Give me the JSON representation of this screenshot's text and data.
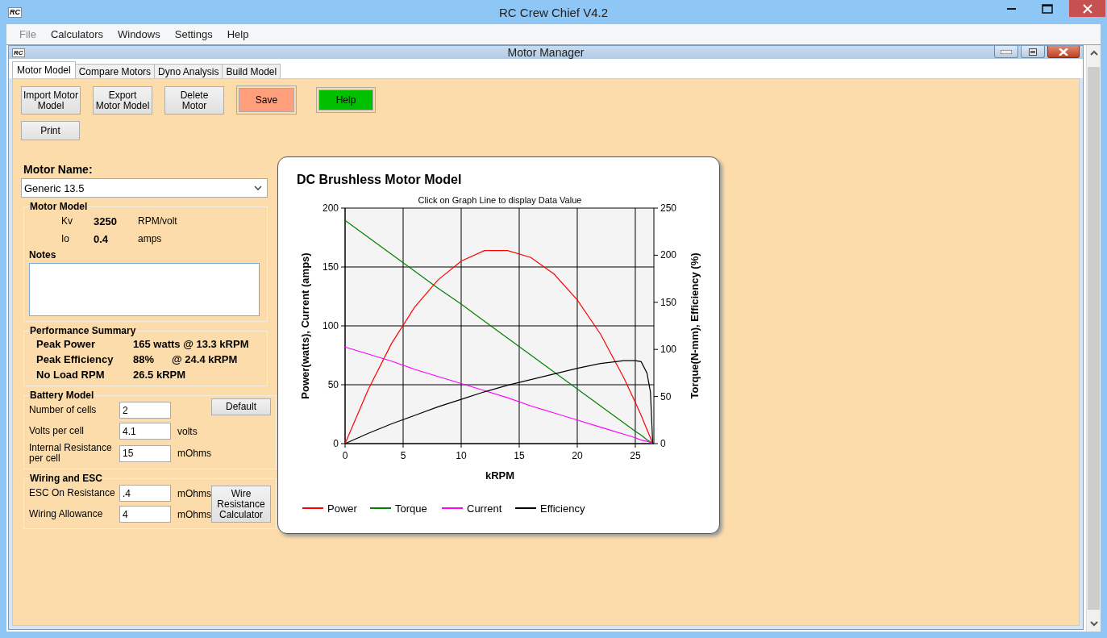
{
  "window": {
    "logo": "RC",
    "title": "RC Crew Chief V4.2"
  },
  "menu": [
    {
      "label": "File",
      "disabled": true
    },
    {
      "label": "Calculators",
      "disabled": false
    },
    {
      "label": "Windows",
      "disabled": false
    },
    {
      "label": "Settings",
      "disabled": false
    },
    {
      "label": "Help",
      "disabled": false
    }
  ],
  "child_window": {
    "logo": "RC",
    "title": "Motor Manager"
  },
  "tabs": [
    {
      "label": "Motor Model",
      "selected": true
    },
    {
      "label": "Compare Motors",
      "selected": false
    },
    {
      "label": "Dyno Analysis",
      "selected": false
    },
    {
      "label": "Build Model",
      "selected": false
    }
  ],
  "buttons": [
    {
      "label": "Import Motor Model",
      "kind": "plain"
    },
    {
      "label": "Export Motor Model",
      "kind": "plain"
    },
    {
      "label": "Delete Motor",
      "kind": "plain"
    },
    {
      "label": "Save",
      "kind": "save"
    },
    {
      "label": "Help",
      "kind": "help"
    }
  ],
  "print_button": "Print",
  "motor_name": {
    "label": "Motor Name:",
    "value": "Generic 13.5"
  },
  "motor_model": {
    "title": "Motor Model",
    "params": [
      {
        "name": "Kv",
        "value": "3250",
        "unit": "RPM/volt"
      },
      {
        "name": "Io",
        "value": "0.4",
        "unit": "amps"
      }
    ],
    "notes_label": "Notes"
  },
  "performance_summary": {
    "title": "Performance Summary",
    "rows": [
      {
        "label": "Peak Power",
        "value": "165 watts @ 13.3 kRPM"
      },
      {
        "label": "Peak Efficiency",
        "value": "88%",
        "extra": "@ 24.4 kRPM"
      },
      {
        "label": "No Load RPM",
        "value": "26.5 kRPM"
      }
    ]
  },
  "battery_model": {
    "title": "Battery Model",
    "button": "Default",
    "fields": [
      {
        "label": "Number of cells",
        "value": "2"
      },
      {
        "label": "Volts per cell",
        "value": "4.1",
        "unit": "volts"
      },
      {
        "label": "Internal Resistance per cell",
        "value": "15",
        "unit": "mOhms"
      }
    ]
  },
  "wiring_esc": {
    "title": "Wiring and ESC",
    "button": "Wire Resistance Calculator",
    "fields": [
      {
        "label": "ESC On Resistance",
        "value": ".4",
        "unit": "mOhms"
      },
      {
        "label": "Wiring Allowance",
        "value": "4",
        "unit": "mOhms"
      }
    ]
  },
  "chart_card": {
    "title": "DC Brushless Motor Model",
    "hint": "Click on Graph Line to display Data Value",
    "chart_data": {
      "type": "line",
      "xlabel": "kRPM",
      "ylabel": "Power(watts), Current (amps)",
      "y2label": "Torque(N-mm), Efficiency (%)",
      "x": [
        0,
        2,
        4,
        6,
        8,
        10,
        12,
        14,
        16,
        18,
        20,
        22,
        24,
        25,
        25.5,
        26,
        26.3,
        26.5
      ],
      "xlim": [
        0,
        26.6
      ],
      "ylim": [
        0,
        200
      ],
      "y2lim": [
        0,
        250
      ],
      "grid": true,
      "legend": "bottom",
      "xticks": [
        0,
        5,
        10,
        15,
        20,
        25
      ],
      "yticks": [
        0,
        50,
        100,
        150,
        200
      ],
      "y2ticks": [
        0,
        50,
        100,
        150,
        200,
        250
      ],
      "series": [
        {
          "name": "Power",
          "color": "#ff0000",
          "values": [
            0,
            46,
            85,
            116,
            139,
            155,
            164,
            164,
            158,
            144,
            122,
            93,
            56,
            35,
            24,
            12,
            5,
            0
          ]
        },
        {
          "name": "Torque",
          "color": "#008000",
          "axis": "y2",
          "values": [
            237,
            219,
            201,
            183,
            165,
            148,
            130,
            112,
            94,
            76,
            58,
            40,
            22,
            13,
            9,
            4,
            2,
            0
          ]
        },
        {
          "name": "Current",
          "color": "#ff00ff",
          "values": [
            82,
            76,
            70,
            63,
            57,
            51,
            45,
            39,
            32,
            26,
            20,
            14,
            8,
            5,
            3,
            2,
            1,
            0
          ]
        },
        {
          "name": "Efficiency",
          "color": "#000000",
          "axis": "y2",
          "values": [
            0,
            11,
            21,
            30,
            39,
            47,
            55,
            62,
            68,
            74,
            80,
            85,
            88,
            88,
            87,
            75,
            55,
            0
          ]
        }
      ]
    }
  }
}
